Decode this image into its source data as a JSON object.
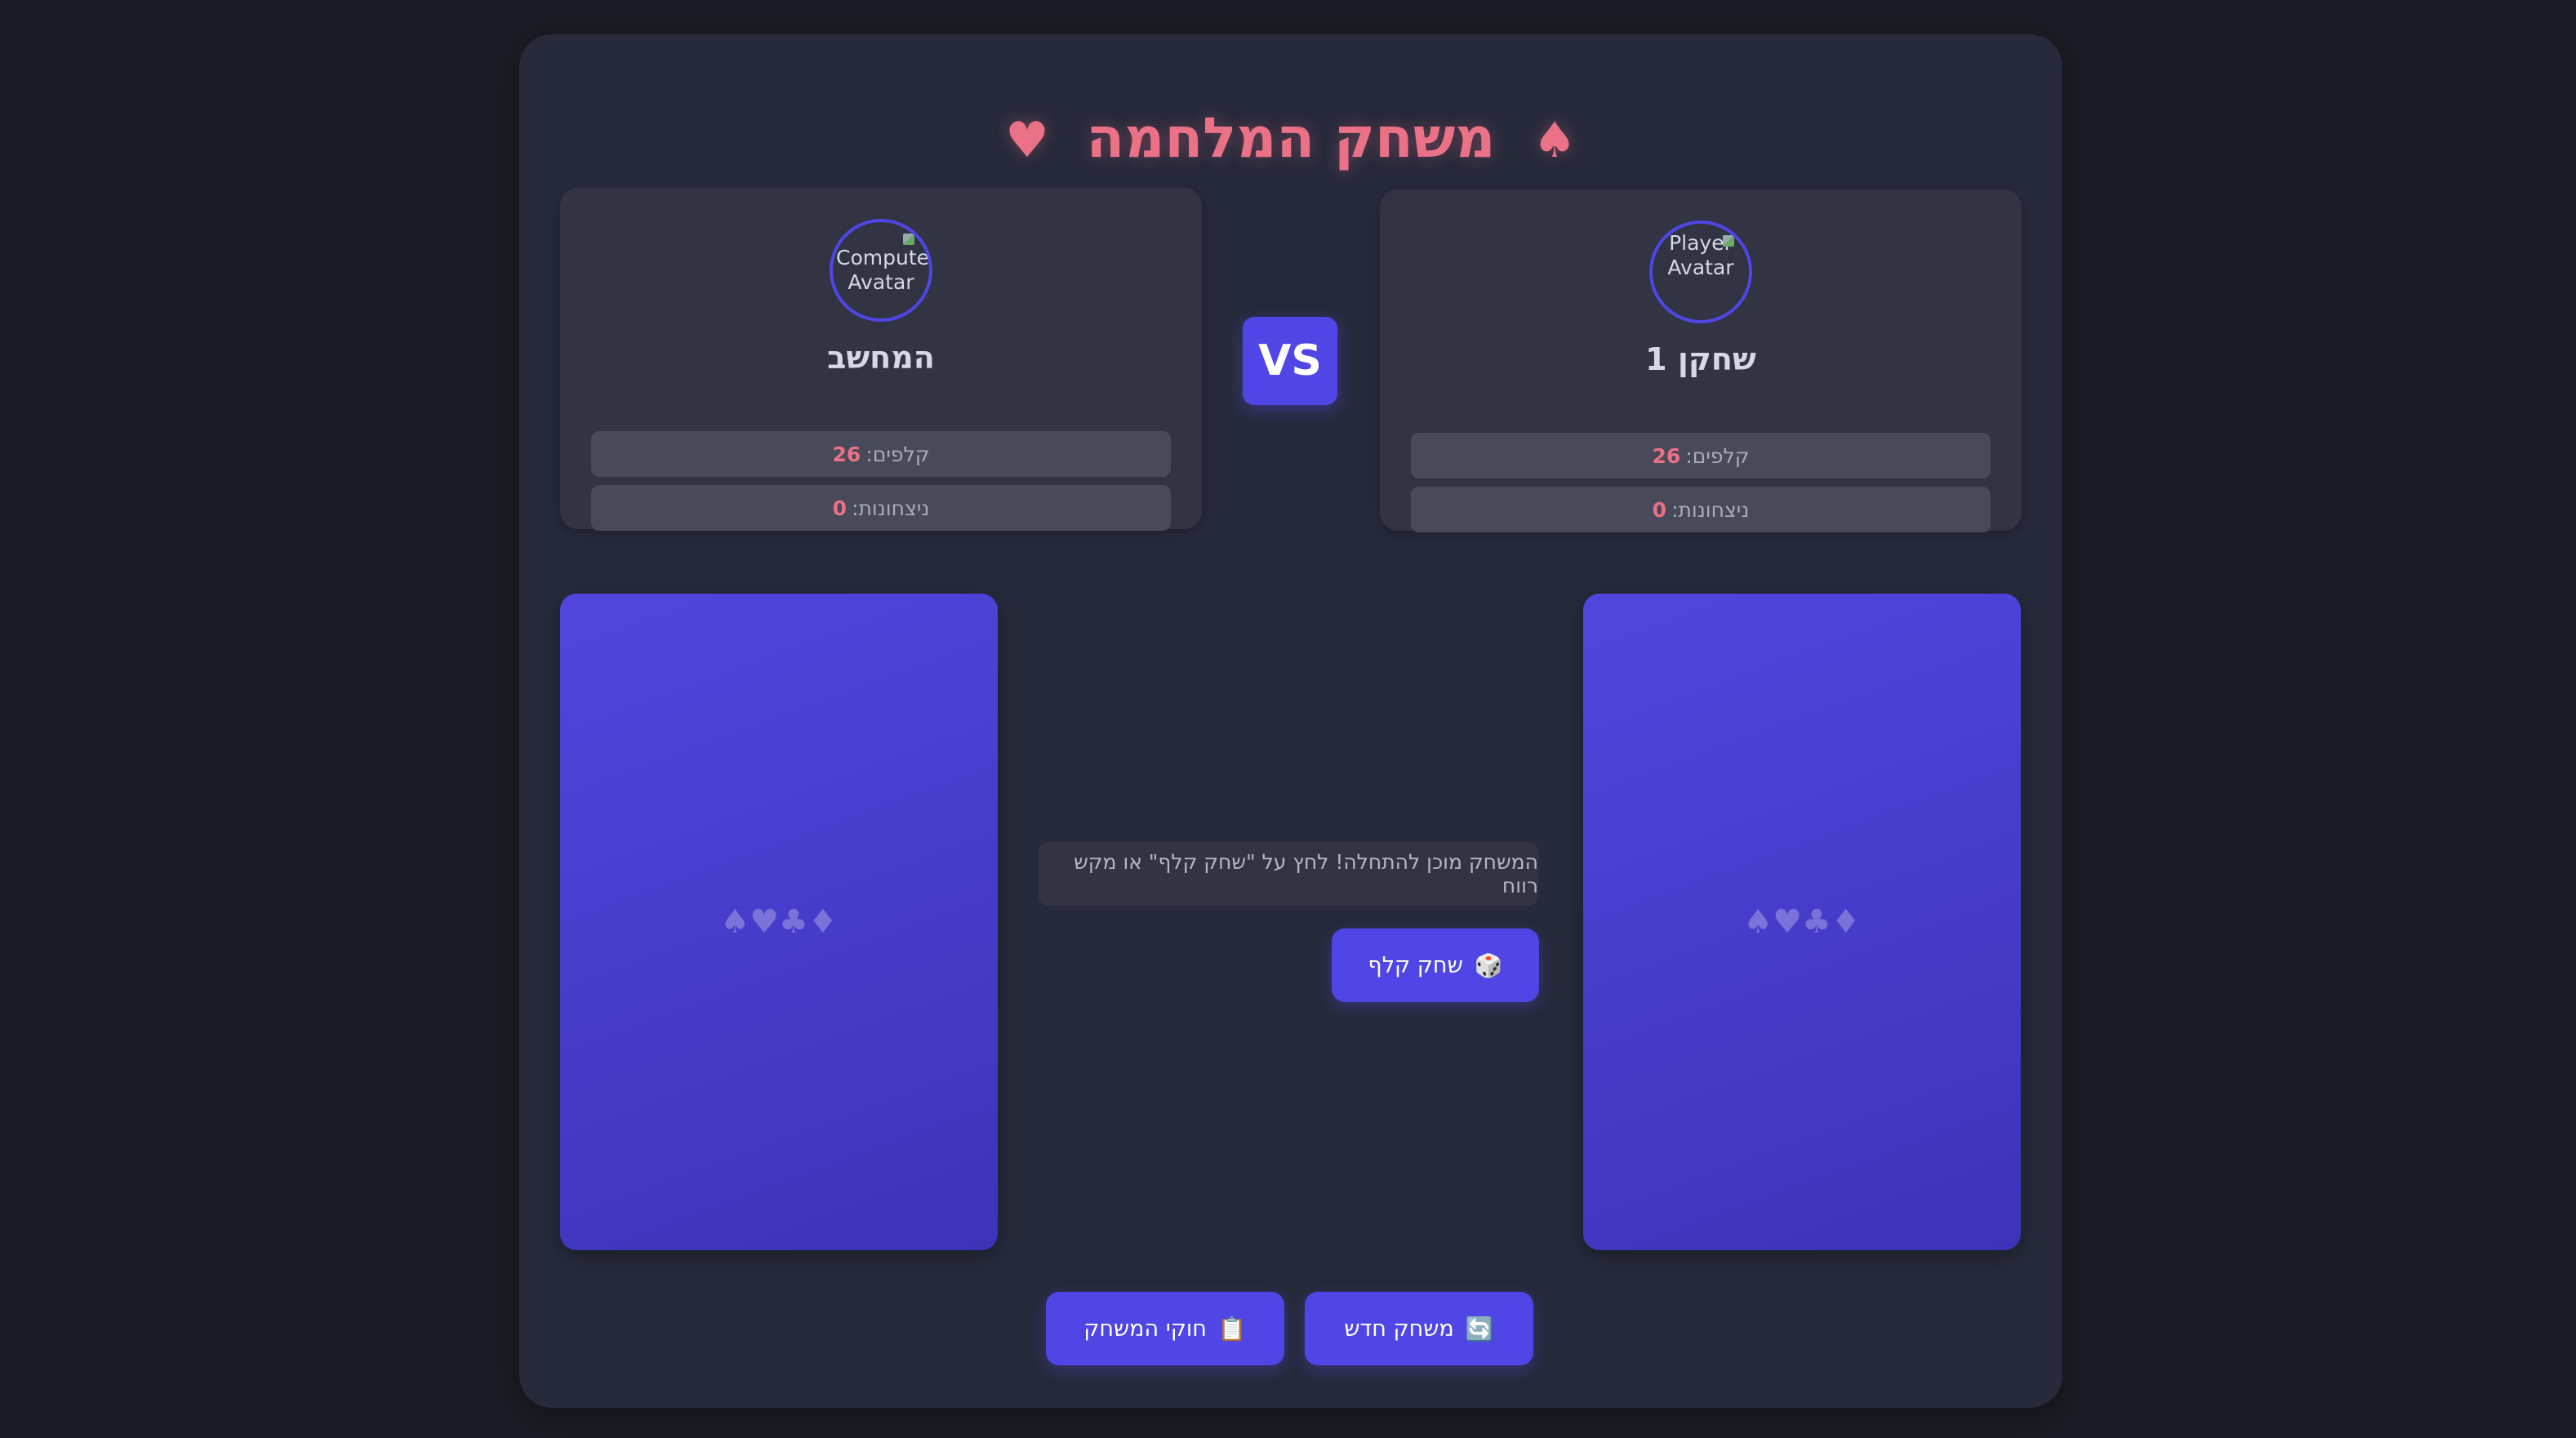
{
  "header": {
    "title": "משחק המלחמה",
    "left_suit": "♠",
    "right_suit": "♥"
  },
  "computer": {
    "avatar_alt": "Computer Avatar",
    "name": "המחשב",
    "cards_label": "קלפים:",
    "cards_value": "26",
    "wins_label": "ניצחונות:",
    "wins_value": "0"
  },
  "player": {
    "avatar_alt": "Player Avatar",
    "name": "שחקן 1",
    "cards_label": "קלפים:",
    "cards_value": "26",
    "wins_label": "ניצחונות:",
    "wins_value": "0"
  },
  "vs_label": "VS",
  "deck_suits": "♠♥♣♦",
  "message": "המשחק מוכן להתחלה! לחץ על \"שחק קלף\" או מקש רווח",
  "buttons": {
    "play_card": "שחק קלף",
    "play_card_icon": "🎲",
    "new_game": "משחק חדש",
    "new_game_icon": "🔄",
    "rules": "חוקי המשחק",
    "rules_icon": "📋"
  },
  "colors": {
    "background": "#1c1c26",
    "panel": "#272a3b",
    "accent": "#4f46e5",
    "highlight": "#ea7186"
  }
}
